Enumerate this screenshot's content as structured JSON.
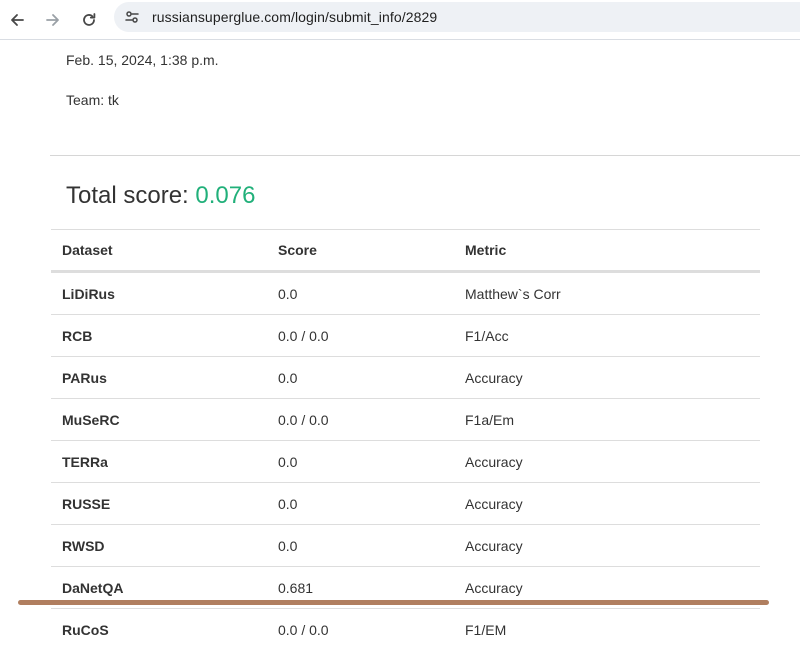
{
  "browser": {
    "url": "russiansuperglue.com/login/submit_info/2829",
    "icons": {
      "back": "arrow-left-icon",
      "forward": "arrow-right-icon",
      "reload": "reload-icon",
      "site_info": "tune-icon"
    }
  },
  "submission": {
    "date": "Feb. 15, 2024, 1:38 p.m.",
    "team": "Team: tk"
  },
  "total": {
    "label": "Total score:",
    "value": "0.076",
    "value_color": "#21b07a"
  },
  "table": {
    "headers": {
      "dataset": "Dataset",
      "score": "Score",
      "metric": "Metric"
    },
    "rows": [
      {
        "dataset": "LiDiRus",
        "score": "0.0",
        "metric": "Matthew`s Corr"
      },
      {
        "dataset": "RCB",
        "score": "0.0 / 0.0",
        "metric": "F1/Acc"
      },
      {
        "dataset": "PARus",
        "score": "0.0",
        "metric": "Accuracy"
      },
      {
        "dataset": "MuSeRC",
        "score": "0.0 / 0.0",
        "metric": "F1a/Em"
      },
      {
        "dataset": "TERRa",
        "score": "0.0",
        "metric": "Accuracy"
      },
      {
        "dataset": "RUSSE",
        "score": "0.0",
        "metric": "Accuracy"
      },
      {
        "dataset": "RWSD",
        "score": "0.0",
        "metric": "Accuracy"
      },
      {
        "dataset": "DaNetQA",
        "score": "0.681",
        "metric": "Accuracy"
      },
      {
        "dataset": "RuCoS",
        "score": "0.0 / 0.0",
        "metric": "F1/EM"
      }
    ]
  },
  "annotation": {
    "underline_color": "#b07e5f"
  }
}
